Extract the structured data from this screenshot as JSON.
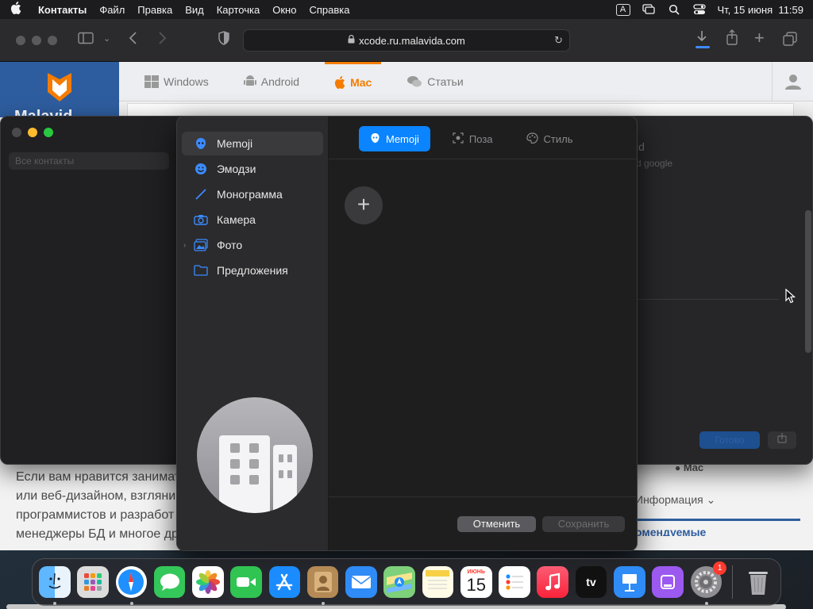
{
  "menubar": {
    "app_name": "Контакты",
    "items": [
      "Файл",
      "Правка",
      "Вид",
      "Карточка",
      "Окно",
      "Справка"
    ],
    "input_badge": "A",
    "datetime": "Чт, 15 июня  11:59"
  },
  "safari": {
    "url": "xcode.ru.malavida.com"
  },
  "website": {
    "logo_text": "Malavid",
    "nav": [
      {
        "label": "Windows",
        "icon": "windows-icon"
      },
      {
        "label": "Android",
        "icon": "android-icon"
      },
      {
        "label": "Mac",
        "icon": "apple-icon",
        "active": true
      },
      {
        "label": "Статьи",
        "icon": "chat-icon"
      }
    ],
    "article_lines": [
      "Если вам нравится занимат",
      "или веб-дизайном, взгляни",
      "программистов и разработ",
      "менеджеры БД и многое др"
    ],
    "sidebar_mac": "Mac",
    "sidebar_info": "Информация",
    "sidebar_recommended": "омендуемые"
  },
  "contacts": {
    "search_placeholder": "Все контакты",
    "ghost_title": "id",
    "ghost_sub": "d google",
    "ghost_button": "Готово"
  },
  "picker": {
    "sidebar": [
      {
        "label": "Memoji",
        "icon": "memoji-icon",
        "selected": true
      },
      {
        "label": "Эмодзи",
        "icon": "emoji-icon"
      },
      {
        "label": "Монограмма",
        "icon": "pencil-icon"
      },
      {
        "label": "Камера",
        "icon": "camera-icon"
      },
      {
        "label": "Фото",
        "icon": "photos-icon"
      },
      {
        "label": "Предложения",
        "icon": "folder-icon"
      }
    ],
    "tabs": [
      {
        "label": "Memoji",
        "icon": "memoji-icon",
        "active": true
      },
      {
        "label": "Поза",
        "icon": "pose-icon"
      },
      {
        "label": "Стиль",
        "icon": "style-icon"
      }
    ],
    "add_label": "+",
    "cancel_label": "Отменить",
    "save_label": "Сохранить",
    "avatar_icon": "building-icon"
  },
  "dock": {
    "apps": [
      "Finder",
      "Launchpad",
      "Safari",
      "Сообщения",
      "Фото",
      "FaceTime",
      "App Store",
      "Контакты",
      "Почта",
      "Карты",
      "Заметки",
      "Календарь",
      "Напоминания",
      "Музыка",
      "TV",
      "Keynote",
      "Podcasts",
      "Системные настройки",
      "Корзина"
    ],
    "calendar_month": "ИЮНЬ",
    "calendar_day": "15",
    "tv_label": "tv",
    "settings_badge": "1"
  },
  "colors": {
    "accent": "#0a84ff",
    "site_orange": "#f57c00",
    "site_blue": "#2e5d9f"
  }
}
